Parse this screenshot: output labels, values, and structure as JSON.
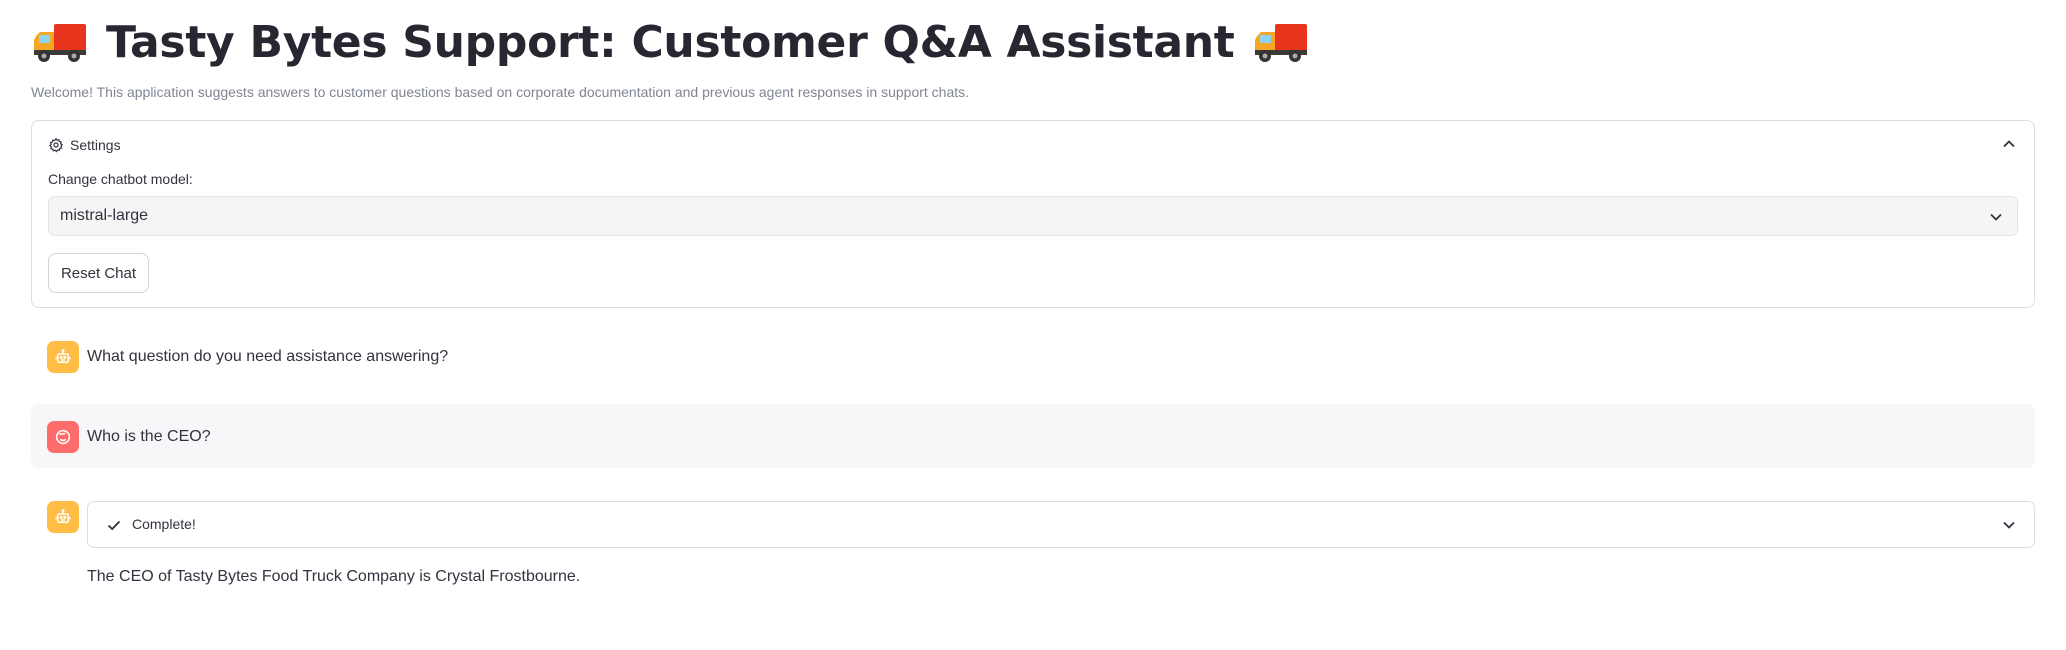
{
  "header": {
    "title": "Tasty Bytes Support: Customer Q&A Assistant",
    "title_icon": "delivery-truck-emoji",
    "welcome": "Welcome! This application suggests answers to customer questions based on corporate documentation and previous agent responses in support chats."
  },
  "settings": {
    "label": "Settings",
    "icon": "gear-icon",
    "expanded": true,
    "model_label": "Change chatbot model:",
    "model_value": "mistral-large",
    "reset_label": "Reset Chat"
  },
  "chat": {
    "messages": [
      {
        "role": "assistant",
        "avatar_icon": "robot-icon",
        "text": "What question do you need assistance answering?"
      },
      {
        "role": "user",
        "avatar_icon": "face-icon",
        "text": "Who is the CEO?"
      },
      {
        "role": "assistant",
        "avatar_icon": "robot-icon",
        "status": "Complete!",
        "text": "The CEO of Tasty Bytes Food Truck Company is Crystal Frostbourne."
      }
    ]
  },
  "colors": {
    "bot_avatar": "#ffbd45",
    "user_avatar": "#ff6c6c",
    "user_row_bg": "#f7f7f9",
    "text": "#31333f",
    "muted_text": "#808495"
  }
}
